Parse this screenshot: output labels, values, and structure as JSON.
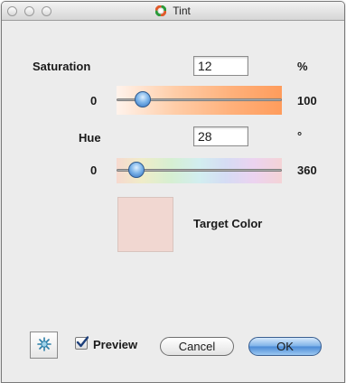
{
  "window": {
    "title": "Tint"
  },
  "saturation": {
    "label": "Saturation",
    "value": "12",
    "unit": "%",
    "min": "0",
    "max": "100",
    "level": 12
  },
  "hue": {
    "label": "Hue",
    "value": "28",
    "unit": "°",
    "min": "0",
    "max": "360",
    "level": 28
  },
  "target": {
    "label": "Target Color",
    "color": "#f1d7d1"
  },
  "footer": {
    "preview_label": "Preview",
    "preview_checked": true,
    "cancel_label": "Cancel",
    "ok_label": "OK"
  },
  "colors": {
    "knob": "#4f8fd8",
    "saturation_end": "#ff9c5c"
  }
}
